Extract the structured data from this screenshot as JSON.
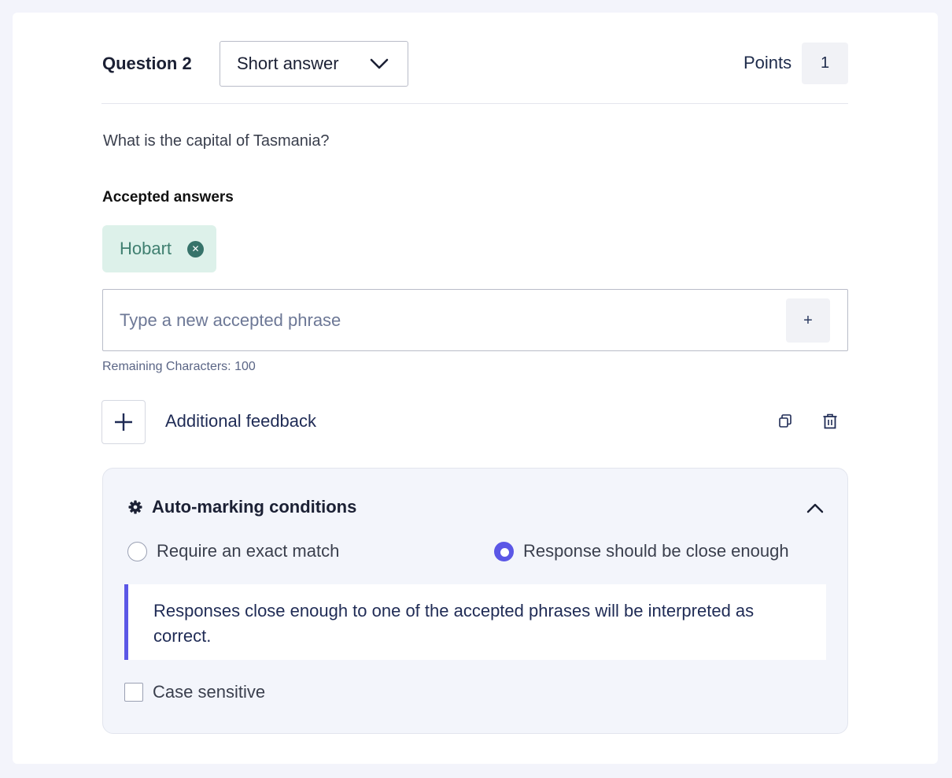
{
  "question": {
    "title": "Question 2",
    "type": {
      "selected": "Short answer",
      "icon": "chevron-down-icon"
    },
    "points_label": "Points",
    "points_value": "1",
    "text": "What is the capital of Tasmania?"
  },
  "accepted_answers": {
    "heading": "Accepted answers",
    "chips": [
      {
        "label": "Hobart",
        "remove_icon": "close-circle-icon"
      }
    ],
    "input_placeholder": "Type a new accepted phrase",
    "input_value": "",
    "add_button_label": "+",
    "remaining": "Remaining Characters: 100"
  },
  "feedback": {
    "label": "Additional feedback",
    "icons": [
      "plus-icon",
      "copy-icon",
      "trash-icon"
    ]
  },
  "auto_marking": {
    "title": "Auto-marking conditions",
    "icon": "gear-icon",
    "expanded": true,
    "options": [
      {
        "label": "Require an exact match",
        "selected": false
      },
      {
        "label": "Response should be close enough",
        "selected": true
      }
    ],
    "info": "Responses close enough to one of the accepted phrases will be interpreted as correct.",
    "case_sensitive": {
      "label": "Case sensitive",
      "checked": false
    }
  },
  "colors": {
    "accent": "#5b57e6",
    "chip_bg": "#ddf1ea",
    "chip_text": "#3f7f70",
    "page_bg": "#f3f4fb"
  }
}
